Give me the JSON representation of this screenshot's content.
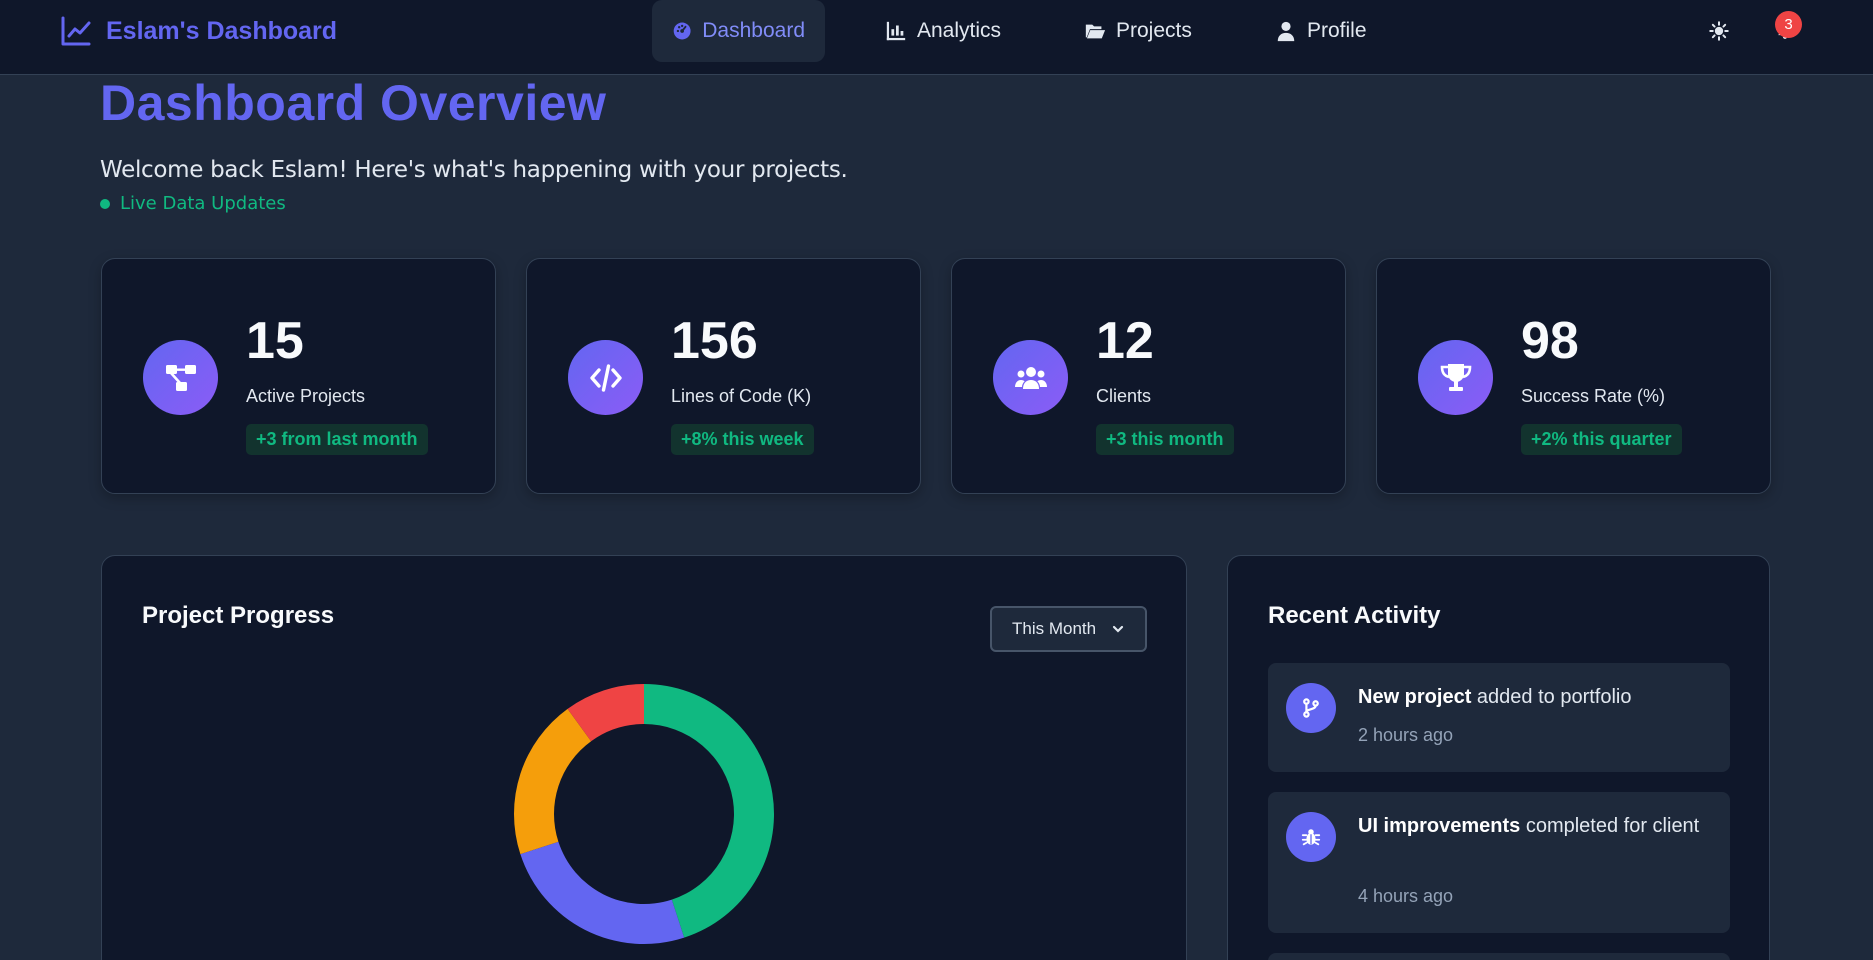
{
  "nav": {
    "brand": "Eslam's Dashboard",
    "items": [
      {
        "label": "Dashboard",
        "icon": "gauge-icon",
        "active": true
      },
      {
        "label": "Analytics",
        "icon": "bar-chart-icon",
        "active": false
      },
      {
        "label": "Projects",
        "icon": "folder-open-icon",
        "active": false
      },
      {
        "label": "Profile",
        "icon": "user-icon",
        "active": false
      }
    ],
    "notification_count": "3"
  },
  "header": {
    "title": "Dashboard Overview",
    "subtitle": "Welcome back Eslam! Here's what's happening with your projects.",
    "live_label": "Live Data Updates"
  },
  "stats": [
    {
      "value": "15",
      "label": "Active Projects",
      "change": "+3 from last month",
      "icon": "project-diagram-icon"
    },
    {
      "value": "156",
      "label": "Lines of Code (K)",
      "change": "+8% this week",
      "icon": "code-icon"
    },
    {
      "value": "12",
      "label": "Clients",
      "change": "+3 this month",
      "icon": "users-icon"
    },
    {
      "value": "98",
      "label": "Success Rate (%)",
      "change": "+2% this quarter",
      "icon": "trophy-icon"
    }
  ],
  "progress": {
    "title": "Project Progress",
    "period": "This Month"
  },
  "chart_data": {
    "type": "pie",
    "variant": "doughnut",
    "title": "",
    "values": [
      45,
      25,
      20,
      10
    ],
    "colors": [
      "#10b981",
      "#6366f1",
      "#f59e0b",
      "#ef4444"
    ]
  },
  "activity": {
    "title": "Recent Activity",
    "items": [
      {
        "bold": "New project",
        "text": " added to portfolio",
        "time": "2 hours ago",
        "icon": "code-branch-icon"
      },
      {
        "bold": "UI improvements",
        "text": " completed for client",
        "time": "4 hours ago",
        "icon": "bug-icon"
      }
    ]
  },
  "colors": {
    "accent": "#6366f1",
    "success": "#10b981",
    "danger": "#ef4444",
    "background": "#1e293b",
    "surface": "#0f172a"
  }
}
